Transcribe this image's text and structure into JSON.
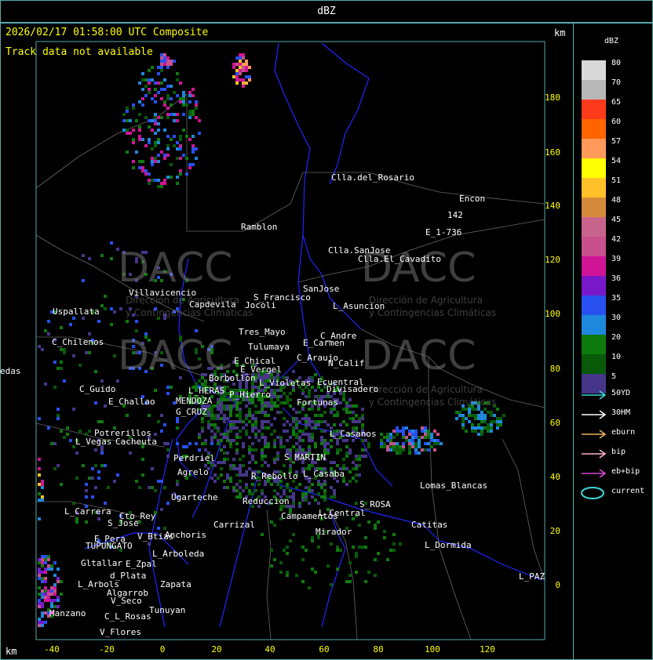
{
  "window_title": "dBZ",
  "header": {
    "timestamp": "2026/02/17 01:58:00 UTC Composite",
    "status": "Track data not available",
    "unit": "km"
  },
  "axes": {
    "x_unit": "km",
    "x_ticks": [
      "-40",
      "-20",
      "0",
      "20",
      "40",
      "60",
      "80",
      "100",
      "120"
    ],
    "y_ticks": [
      "180",
      "160",
      "140",
      "120",
      "100",
      "80",
      "60",
      "40",
      "20",
      "0"
    ]
  },
  "legend": {
    "title": "dBZ",
    "levels": [
      {
        "label": "80",
        "color": "#d8d8d8"
      },
      {
        "label": "70",
        "color": "#b8b8b8"
      },
      {
        "label": "65",
        "color": "#ff3a1a"
      },
      {
        "label": "60",
        "color": "#ff6400"
      },
      {
        "label": "57",
        "color": "#ff9a5a"
      },
      {
        "label": "54",
        "color": "#ffff00"
      },
      {
        "label": "51",
        "color": "#ffc028"
      },
      {
        "label": "48",
        "color": "#d48a3a"
      },
      {
        "label": "45",
        "color": "#c8648c"
      },
      {
        "label": "42",
        "color": "#c8508c"
      },
      {
        "label": "39",
        "color": "#d01496"
      },
      {
        "label": "36",
        "color": "#7818c8"
      },
      {
        "label": "35",
        "color": "#2850f0"
      },
      {
        "label": "30",
        "color": "#1e88dc"
      },
      {
        "label": "20",
        "color": "#0e7a0e"
      },
      {
        "label": "10",
        "color": "#085a08"
      },
      {
        "label": "5",
        "color": "#46368a"
      }
    ],
    "tracks": [
      {
        "label": "50YD",
        "color": "#3cd8d8"
      },
      {
        "label": "30HM",
        "color": "#ffffff"
      },
      {
        "label": "eburn",
        "color": "#e8b464"
      },
      {
        "label": "bip",
        "color": "#ffb4c8"
      },
      {
        "label": "eb+bip",
        "color": "#d846d8"
      },
      {
        "label": "current",
        "color": "#3cd8d8"
      }
    ]
  },
  "watermark": {
    "brand": "DACC",
    "line1": "Dirección de Agricultura",
    "line2": "y Contingencias Climáticas"
  },
  "places": [
    "Clla.del_Rosario",
    "Encon",
    "142",
    "E_1-736",
    "Ramblon",
    "Clla.SanJose",
    "Clla.El_Cavadito",
    "S_Francisco",
    "Jocoli",
    "SanJose",
    "L_Asuncion",
    "Villavicencio",
    "Capdevila",
    "Uspallata",
    "Tres_Mayo",
    "Tulumaya",
    "C_Andre",
    "E_Carmen",
    "C_Chilenos",
    "E_Chical",
    "E_Vergel",
    "C_Araujo",
    "N_Calif",
    "edas",
    "Borbollon",
    "L_Violetas",
    "Ecuentral",
    "Divisadero",
    "C_Guido",
    "L_HERAS",
    "P_Hierro",
    "Fortunas",
    "E_Challao",
    "MENDOZA",
    "G_CRUZ",
    "Potrerillos",
    "Cacheuta",
    "L_Vegas",
    "L_Casanos",
    "Perdriel",
    "Agrelo",
    "S_MARTIN",
    "L_Casaba",
    "Ugarteche",
    "R_Rebollo",
    "Lomas_Blancas",
    "S_ROSA",
    "Reduccion",
    "Campamentos",
    "L_Carrera",
    "Cto_Rey",
    "S_Jose",
    "Carrizal",
    "Catitas",
    "E_Pera",
    "TUPUNGATO",
    "V_Btias",
    "Anchoris",
    "Mirador",
    "L_Dormida",
    "L_Arboleda",
    "Gltallar",
    "E_Zpal",
    "d_Plata",
    "Zapata",
    "L_Arbols",
    "Algarrob",
    "V_Seco",
    "Tunuyan",
    "Manzano",
    "C_L_Rosas",
    "V_Flores",
    "L_PAZ",
    "L_Central"
  ]
}
